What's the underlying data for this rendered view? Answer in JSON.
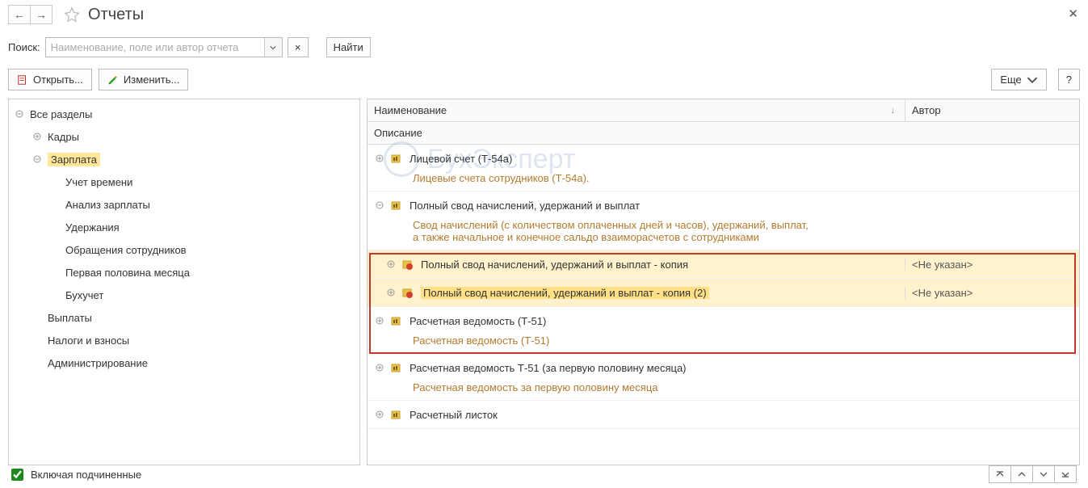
{
  "title": "Отчеты",
  "search": {
    "label": "Поиск:",
    "placeholder": "Наименование, поле или автор отчета",
    "findLabel": "Найти"
  },
  "toolbar": {
    "open": "Открыть...",
    "edit": "Изменить...",
    "more": "Еще",
    "help": "?"
  },
  "tree": {
    "root": "Все разделы",
    "items": [
      {
        "label": "Кадры",
        "level": 1,
        "exp": "plus"
      },
      {
        "label": "Зарплата",
        "level": 1,
        "exp": "minus",
        "selected": true
      },
      {
        "label": "Учет времени",
        "level": 2,
        "exp": "none"
      },
      {
        "label": "Анализ зарплаты",
        "level": 2,
        "exp": "none"
      },
      {
        "label": "Удержания",
        "level": 2,
        "exp": "none"
      },
      {
        "label": "Обращения сотрудников",
        "level": 2,
        "exp": "none"
      },
      {
        "label": "Первая половина месяца",
        "level": 2,
        "exp": "none"
      },
      {
        "label": "Бухучет",
        "level": 2,
        "exp": "none"
      },
      {
        "label": "Выплаты",
        "level": 1,
        "exp": "none"
      },
      {
        "label": "Налоги и взносы",
        "level": 1,
        "exp": "none"
      },
      {
        "label": "Администрирование",
        "level": 1,
        "exp": "none"
      }
    ]
  },
  "grid": {
    "headers": {
      "name": "Наименование",
      "author": "Автор",
      "desc": "Описание"
    },
    "rows": [
      {
        "icon": "yellow",
        "exp": "plus",
        "level": 1,
        "name": "Лицевой счет (Т-54а)",
        "author": "",
        "desc": "Лицевые счета сотрудников (Т-54а).",
        "highlight": false
      },
      {
        "icon": "yellow",
        "exp": "minus",
        "level": 1,
        "name": "Полный свод начислений, удержаний и выплат",
        "author": "",
        "desc": "Свод начислений (с количеством оплаченных дней и часов), удержаний, выплат,\nа также начальное и конечное сальдо взаиморасчетов с сотрудниками",
        "highlight": false
      },
      {
        "icon": "red",
        "exp": "plus",
        "level": 2,
        "name": "Полный свод начислений, удержаний и выплат - копия",
        "author": "<Не указан>",
        "desc": "",
        "highlight": true
      },
      {
        "icon": "red",
        "exp": "plus",
        "level": 2,
        "name": "Полный свод начислений, удержаний и выплат - копия (2)",
        "author": "<Не указан>",
        "desc": "",
        "highlight": true,
        "selected": true
      },
      {
        "icon": "yellow",
        "exp": "plus",
        "level": 1,
        "name": "Расчетная ведомость (Т-51)",
        "author": "",
        "desc": "Расчетная ведомость (Т-51)",
        "highlight": false
      },
      {
        "icon": "yellow",
        "exp": "plus",
        "level": 1,
        "name": "Расчетная ведомость Т-51 (за первую половину месяца)",
        "author": "",
        "desc": "Расчетная ведомость за первую половину месяца",
        "highlight": false
      },
      {
        "icon": "yellow",
        "exp": "plus",
        "level": 1,
        "name": "Расчетный листок",
        "author": "",
        "desc": "",
        "highlight": false
      }
    ]
  },
  "footer": {
    "checkbox": "Включая подчиненные",
    "checked": true
  },
  "watermark": "БухЭксперт"
}
